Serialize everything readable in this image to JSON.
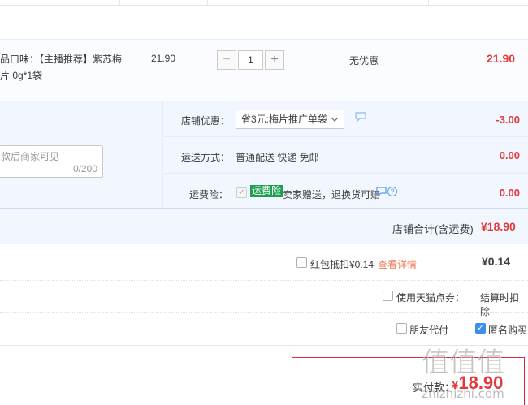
{
  "item": {
    "name": "品口味：【主播推荐】紫苏梅片 0g*1袋",
    "price": "21.90",
    "quantity": "1",
    "minus_label": "−",
    "plus_label": "+",
    "discount": "无优惠",
    "subtotal": "21.90"
  },
  "shop": {
    "message_placeholder": "款后商家可见",
    "message_count": "0/200",
    "coupon_label": "店铺优惠：",
    "coupon_selected": "省3元:梅片推广单袋",
    "coupon_amount": "-3.00",
    "shipping_label": "运送方式：",
    "shipping_text": "普通配送 快递 免邮",
    "shipping_amount": "0.00",
    "insurance_label": "运费险：",
    "insurance_tag": "运费险",
    "insurance_desc": "卖家赠送，退换货可赔",
    "insurance_amount": "0.00",
    "total_label": "店铺合计(含运费)",
    "total_value": "¥18.90"
  },
  "hongbao": {
    "label": "红包抵扣¥0.14",
    "link": "查看详情",
    "value": "¥0.14"
  },
  "tmall_points": {
    "label": "使用天猫点券：",
    "value": "结算时扣除"
  },
  "options": {
    "friend_pay": "朋友代付",
    "anonymous": "匿名购买"
  },
  "payment": {
    "label": "实付款：",
    "symbol": "¥",
    "value": "18.90"
  },
  "watermark": {
    "text": "值值值",
    "url": "zhizhizhi.com"
  },
  "colors": {
    "price_red": "#e4393c",
    "link_orange": "#f07c5a",
    "tag_green": "#1e9e50",
    "check_blue": "#3d8eea",
    "panel_bg": "#f2f7ff"
  }
}
